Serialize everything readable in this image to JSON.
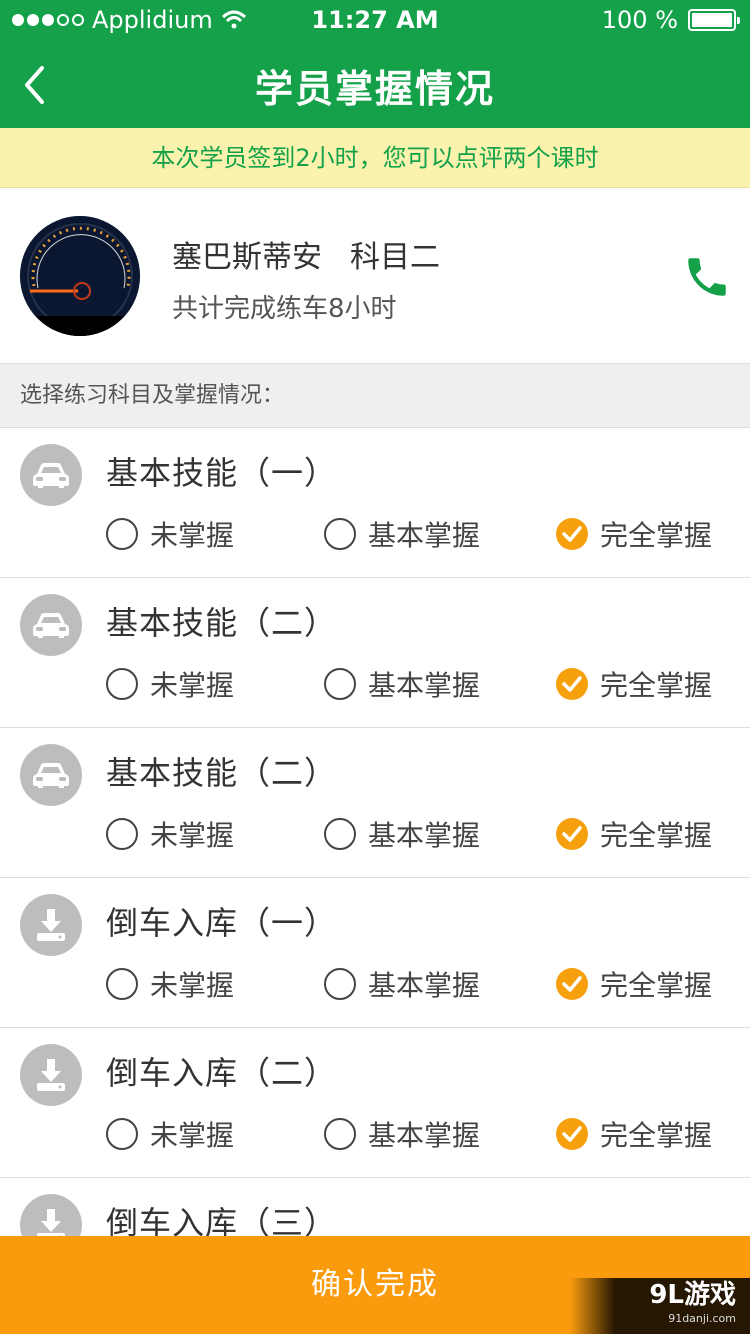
{
  "status_bar": {
    "carrier": "Applidium",
    "time": "11:27 AM",
    "battery": "100 %"
  },
  "header": {
    "title": "学员掌握情况"
  },
  "notice": {
    "text": "本次学员签到2小时，您可以点评两个课时"
  },
  "student": {
    "name": "塞巴斯蒂安",
    "subject": "科目二",
    "hours": "共计完成练车8小时"
  },
  "section_label": "选择练习科目及掌握情况：",
  "options": {
    "not_mastered": "未掌握",
    "basic": "基本掌握",
    "full": "完全掌握"
  },
  "items": [
    {
      "title": "基本技能（一）",
      "icon": "car-icon",
      "selected": "full"
    },
    {
      "title": "基本技能（二）",
      "icon": "car-icon",
      "selected": "full"
    },
    {
      "title": "基本技能（二）",
      "icon": "car-icon",
      "selected": "full"
    },
    {
      "title": "倒车入库（一）",
      "icon": "download-icon",
      "selected": "full"
    },
    {
      "title": "倒车入库（二）",
      "icon": "download-icon",
      "selected": "full"
    },
    {
      "title": "倒车入库（三）",
      "icon": "download-icon",
      "selected": ""
    }
  ],
  "confirm_label": "确认完成",
  "watermark": {
    "main": "9L游戏",
    "sub": "91danji.com"
  },
  "colors": {
    "primary": "#14a14a",
    "accent": "#f99b0d",
    "notice_bg": "#fbf3ad"
  }
}
